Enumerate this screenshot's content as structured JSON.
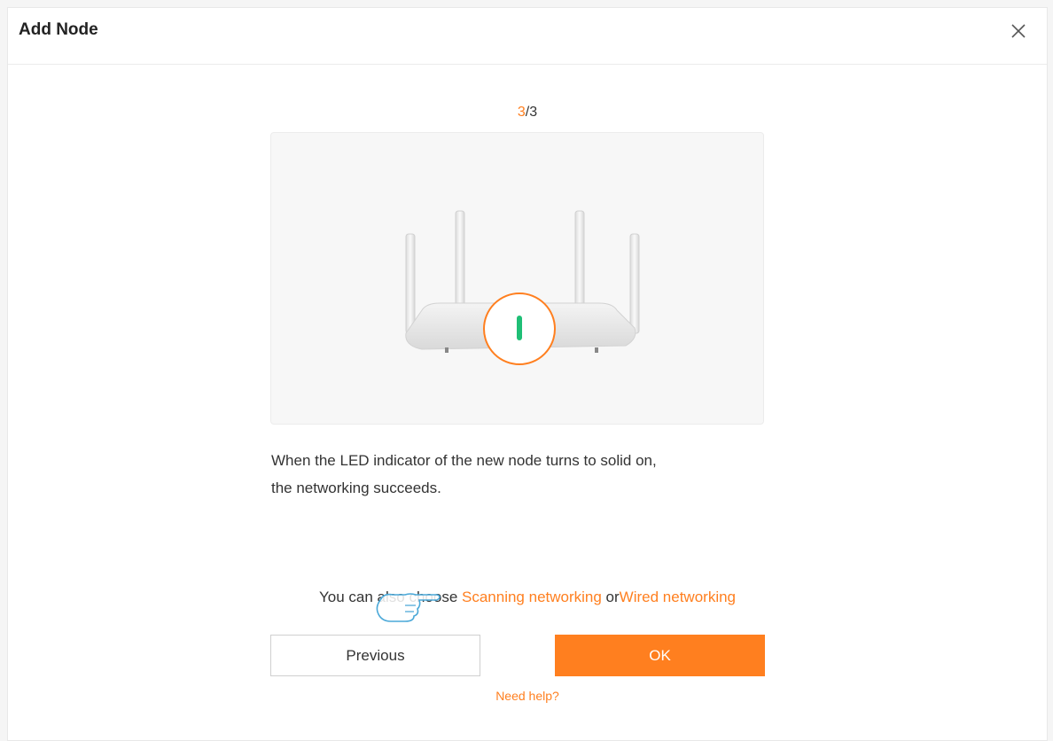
{
  "dialog": {
    "title": "Add Node",
    "close_icon": "close-icon"
  },
  "step": {
    "current": "3",
    "total": "/3"
  },
  "illustration": {
    "icon": "router-led-icon",
    "led_color": "#1fbf76",
    "accent_color": "#ff7f1f"
  },
  "description": {
    "line1": "When the LED indicator of the new node turns to solid on,",
    "line2": "the networking succeeds."
  },
  "alternatives": {
    "prefix": "You can also choose ",
    "scanning_link": "Scanning networking",
    "or_text": " or",
    "wired_link": "Wired networking"
  },
  "buttons": {
    "previous": "Previous",
    "ok": "OK"
  },
  "help": {
    "label": "Need help?"
  },
  "colors": {
    "accent": "#ff7f1f",
    "led": "#1fbf76"
  }
}
